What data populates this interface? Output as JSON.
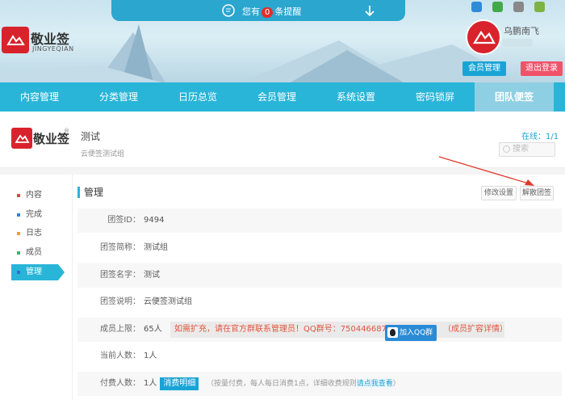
{
  "notice": {
    "prefix": "您有",
    "count": "0",
    "suffix": "条提醒"
  },
  "logo": {
    "title": "敬业签",
    "sub": "JINGYEQIAN"
  },
  "user": {
    "name": "乌鹏南飞",
    "member_button": "会员管理",
    "logout_button": "退出登录"
  },
  "nav": {
    "items": [
      "内容管理",
      "分类管理",
      "日历总览",
      "会员管理",
      "系统设置",
      "密码锁屏",
      "团队便签"
    ],
    "active": "团队便签"
  },
  "group": {
    "brand": "敬业签",
    "reg": "®",
    "name": "测试",
    "desc": "云便签测试组",
    "online": "在线：1/1",
    "search_placeholder": "搜索"
  },
  "sidebar": {
    "items": [
      {
        "label": "内容",
        "color": "#e04343"
      },
      {
        "label": "完成",
        "color": "#3a7bd5"
      },
      {
        "label": "日志",
        "color": "#f0a020"
      },
      {
        "label": "成员",
        "color": "#2fb86a"
      },
      {
        "label": "管理",
        "color": "#2a6fd8"
      }
    ]
  },
  "panel": {
    "title": "管理",
    "edit_button": "修改设置",
    "dissolve_button": "解散团签"
  },
  "fields": {
    "id": {
      "label": "团签ID：",
      "value": "9494"
    },
    "short": {
      "label": "团签简称：",
      "value": "测试组"
    },
    "name": {
      "label": "团签名字：",
      "value": "测试"
    },
    "desc": {
      "label": "团签说明：",
      "value": "云便签测试组"
    },
    "limit": {
      "label": "成员上限：",
      "value": "65人",
      "warning": "如需扩充，请在官方群联系管理员！QQ群号：750446687",
      "qq_button": "加入QQ群",
      "expand": "（成员扩容详情）"
    },
    "current": {
      "label": "当前人数：",
      "value": "1人"
    },
    "paid": {
      "label": "付费人数：",
      "value": "1人",
      "badge": "消费明细",
      "note": "（按量付费，每人每日消费1点，详细收费规则",
      "link": "请点我查看",
      "note_end": "）"
    }
  }
}
